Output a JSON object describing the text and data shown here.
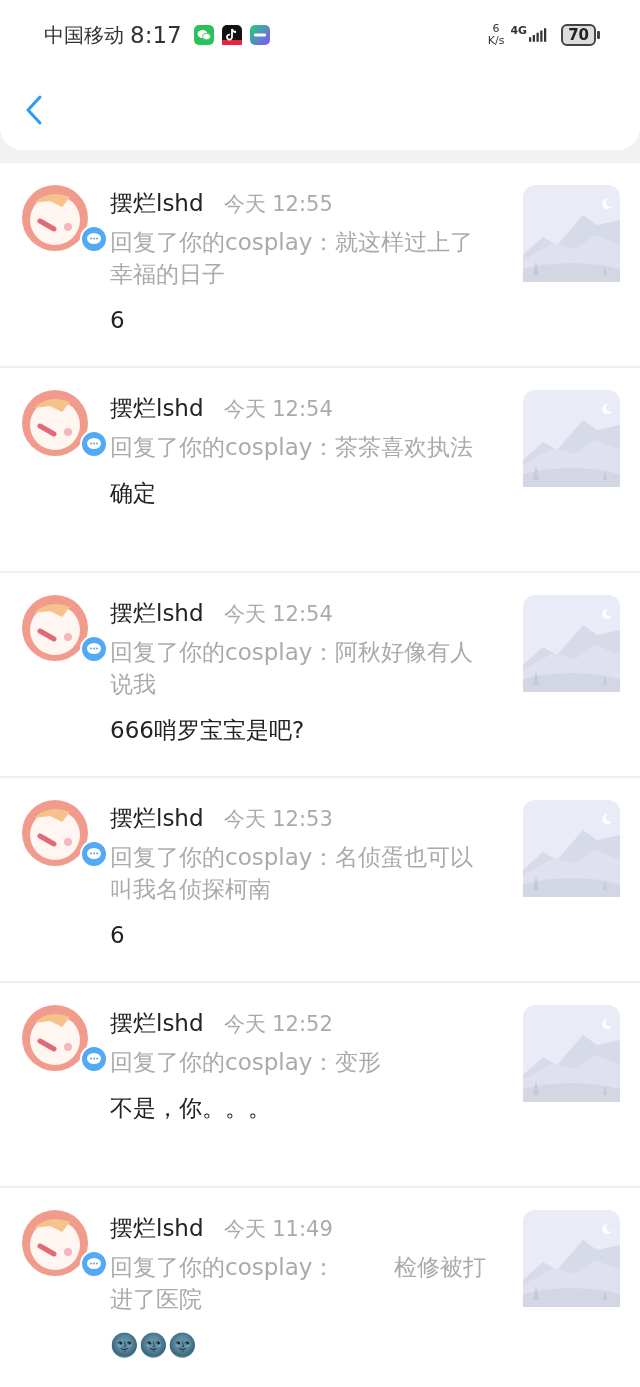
{
  "status_bar": {
    "carrier": "中国移动",
    "time": "8:17",
    "speed_value": "6",
    "speed_unit": "K/s",
    "network": "4G",
    "battery": "70"
  },
  "comments": [
    {
      "name": "摆烂lshd",
      "time": "今天 12:55",
      "quote": "回复了你的cosplay：就这样过上了幸福的日子",
      "reply": "6"
    },
    {
      "name": "摆烂lshd",
      "time": "今天 12:54",
      "quote": "回复了你的cosplay：茶茶喜欢执法",
      "reply": "确定"
    },
    {
      "name": "摆烂lshd",
      "time": "今天 12:54",
      "quote": "回复了你的cosplay：阿秋好像有人说我",
      "reply": "666哨罗宝宝是吧?"
    },
    {
      "name": "摆烂lshd",
      "time": "今天 12:53",
      "quote": "回复了你的cosplay：名侦蛋也可以叫我名侦探柯南",
      "reply": "6"
    },
    {
      "name": "摆烂lshd",
      "time": "今天 12:52",
      "quote": "回复了你的cosplay：变形",
      "reply": "不是，你。。。"
    },
    {
      "name": "摆烂lshd",
      "time": "今天 11:49",
      "quote": "回复了你的cosplay：        检修被打进了医院",
      "reply": "🌚🌚🌚"
    }
  ]
}
